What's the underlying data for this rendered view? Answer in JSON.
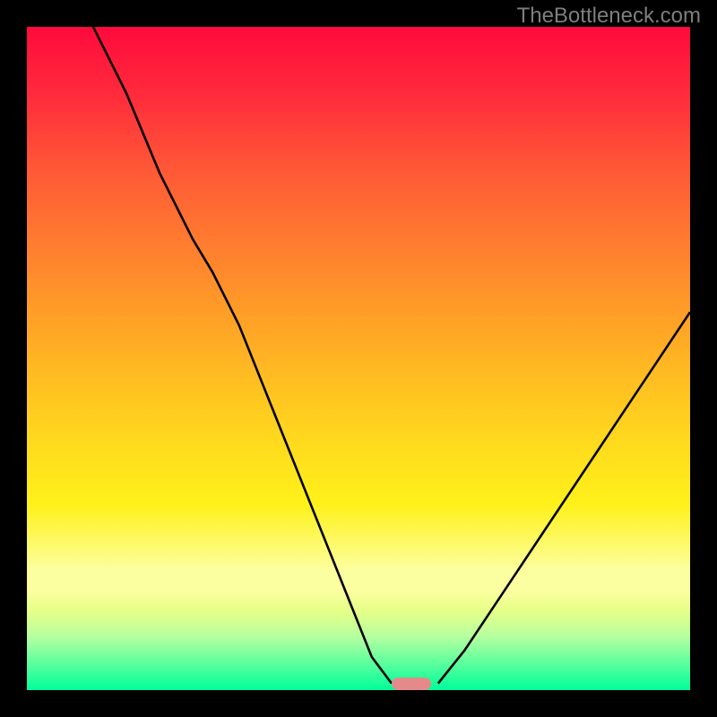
{
  "watermark": "TheBottleneck.com",
  "chart_data": {
    "type": "line",
    "title": "",
    "xlabel": "",
    "ylabel": "",
    "xlim": [
      0,
      100
    ],
    "ylim": [
      0,
      100
    ],
    "grid": false,
    "legend_position": "none",
    "gradient_stops": [
      {
        "pos": 0,
        "color": "#ff0a3c"
      },
      {
        "pos": 50,
        "color": "#ffd81e"
      },
      {
        "pos": 85,
        "color": "#fcffa0"
      },
      {
        "pos": 100,
        "color": "#00ff9a"
      }
    ],
    "marker": {
      "x_center": 58,
      "y": 99,
      "width": 6,
      "color": "#e58a8a"
    },
    "series": [
      {
        "name": "left-curve",
        "x": [
          10,
          15,
          20,
          25,
          28,
          32,
          36,
          40,
          44,
          48,
          52,
          55
        ],
        "y": [
          100,
          90,
          78,
          68,
          63,
          55,
          45,
          35,
          25,
          15,
          5,
          1
        ]
      },
      {
        "name": "right-curve",
        "x": [
          62,
          66,
          70,
          74,
          78,
          82,
          86,
          90,
          94,
          98,
          100
        ],
        "y": [
          1,
          6,
          12,
          18,
          24,
          30,
          36,
          42,
          48,
          54,
          57
        ]
      }
    ]
  }
}
